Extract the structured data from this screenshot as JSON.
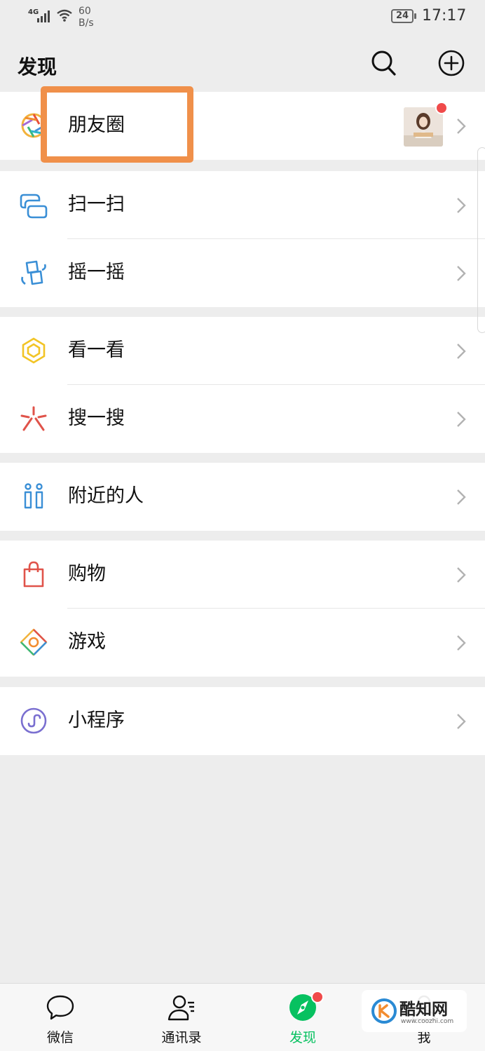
{
  "status_bar": {
    "network": "4G",
    "speed_value": "60",
    "speed_unit": "B/s",
    "battery": "24",
    "time": "17:17"
  },
  "header": {
    "title": "发现",
    "icons": [
      "search-icon",
      "add-icon"
    ]
  },
  "groups": [
    {
      "items": [
        {
          "label": "朋友圈",
          "icon": "moments-icon",
          "has_thumbnail": true,
          "unread_dot": true
        }
      ]
    },
    {
      "items": [
        {
          "label": "扫一扫",
          "icon": "scan-icon"
        },
        {
          "label": "摇一摇",
          "icon": "shake-icon"
        }
      ]
    },
    {
      "items": [
        {
          "label": "看一看",
          "icon": "top-stories-icon"
        },
        {
          "label": "搜一搜",
          "icon": "search-discover-icon"
        }
      ]
    },
    {
      "items": [
        {
          "label": "附近的人",
          "icon": "people-nearby-icon"
        }
      ]
    },
    {
      "items": [
        {
          "label": "购物",
          "icon": "shopping-bag-icon"
        },
        {
          "label": "游戏",
          "icon": "games-icon"
        }
      ]
    },
    {
      "items": [
        {
          "label": "小程序",
          "icon": "mini-programs-icon"
        }
      ]
    }
  ],
  "highlight": {
    "target": "朋友圈",
    "color": "#f0904a"
  },
  "bottom_nav": {
    "tabs": [
      {
        "label": "微信",
        "icon": "chat-bubble-icon"
      },
      {
        "label": "通讯录",
        "icon": "contacts-icon"
      },
      {
        "label": "发现",
        "icon": "compass-icon",
        "active": true,
        "unread_dot": true
      },
      {
        "label": "我",
        "icon": "me-icon"
      }
    ]
  },
  "watermark": {
    "name": "酷知网",
    "url": "www.coozhi.com"
  },
  "colors": {
    "background": "#ededed",
    "accent_green": "#07c160",
    "badge_red": "#f04a4a",
    "highlight_orange": "#f0904a"
  }
}
